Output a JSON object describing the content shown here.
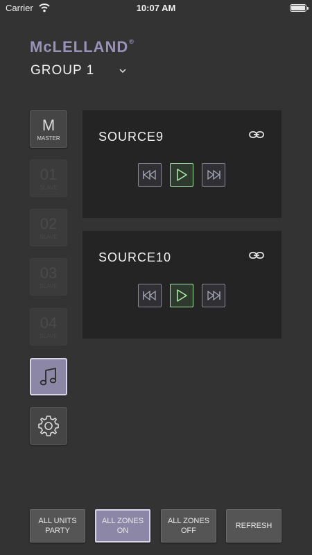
{
  "status_bar": {
    "carrier": "Carrier",
    "time": "10:07 AM"
  },
  "brand": {
    "name": "McLELLAND",
    "reg": "®"
  },
  "group": {
    "label": "GROUP 1"
  },
  "sidebar": {
    "master": {
      "big": "M",
      "small": "MASTER"
    },
    "slaves": [
      {
        "big": "01",
        "small": "SLAVE"
      },
      {
        "big": "02",
        "small": "SLAVE"
      },
      {
        "big": "03",
        "small": "SLAVE"
      },
      {
        "big": "04",
        "small": "SLAVE"
      }
    ],
    "music_icon": "music-note-icon",
    "settings_icon": "gear-icon"
  },
  "sources": [
    {
      "name": "SOURCE9"
    },
    {
      "name": "SOURCE10"
    }
  ],
  "bottom": {
    "all_units_party": "ALL UNITS\nPARTY",
    "all_zones_on": "ALL ZONES\nON",
    "all_zones_off": "ALL ZONES\nOFF",
    "refresh": "REFRESH"
  },
  "colors": {
    "background": "#333333",
    "accent": "#8d87a7",
    "play_accent": "#a8e8a8",
    "brand": "#9a92b8"
  }
}
